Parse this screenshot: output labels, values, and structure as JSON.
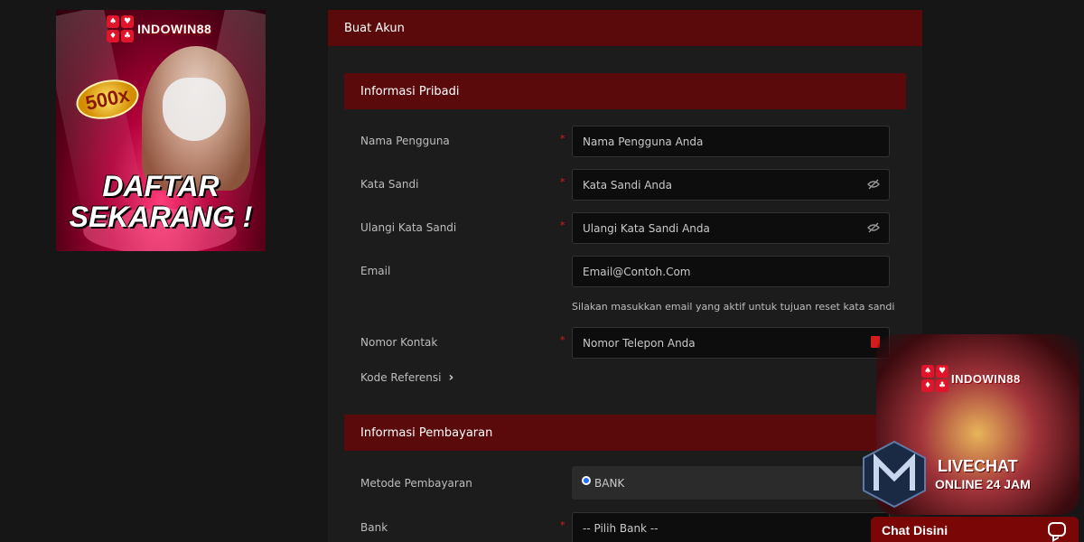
{
  "banner": {
    "logo": "INDOWIN88",
    "multiplier": "500x",
    "cta_line1": "DAFTAR",
    "cta_line2": "SEKARANG !"
  },
  "form": {
    "title": "Buat Akun",
    "personal": {
      "heading": "Informasi Pribadi",
      "username": {
        "label": "Nama Pengguna",
        "placeholder": "Nama Pengguna Anda",
        "required": true
      },
      "password": {
        "label": "Kata Sandi",
        "placeholder": "Kata Sandi Anda",
        "required": true
      },
      "confirm_password": {
        "label": "Ulangi Kata Sandi",
        "placeholder": "Ulangi Kata Sandi Anda",
        "required": true
      },
      "email": {
        "label": "Email",
        "placeholder": "Email@Contoh.Com",
        "hint": "Silakan masukkan email yang aktif untuk tujuan reset kata sandi"
      },
      "phone": {
        "label": "Nomor Kontak",
        "placeholder": "Nomor Telepon Anda",
        "required": true
      },
      "referral": {
        "label": "Kode Referensi"
      }
    },
    "payment": {
      "heading": "Informasi Pembayaran",
      "method": {
        "label": "Metode Pembayaran",
        "option": "BANK"
      },
      "bank": {
        "label": "Bank",
        "placeholder": "-- Pilih Bank --",
        "required": true
      }
    },
    "required_mark": "*"
  },
  "livechat": {
    "logo": "INDOWIN88",
    "line1": "LIVECHAT",
    "line2": "ONLINE 24 JAM",
    "button": "Chat Disini"
  },
  "colors": {
    "header_bg": "#5a0a0a",
    "accent_red": "#e21b1b",
    "page_bg": "#161616"
  }
}
